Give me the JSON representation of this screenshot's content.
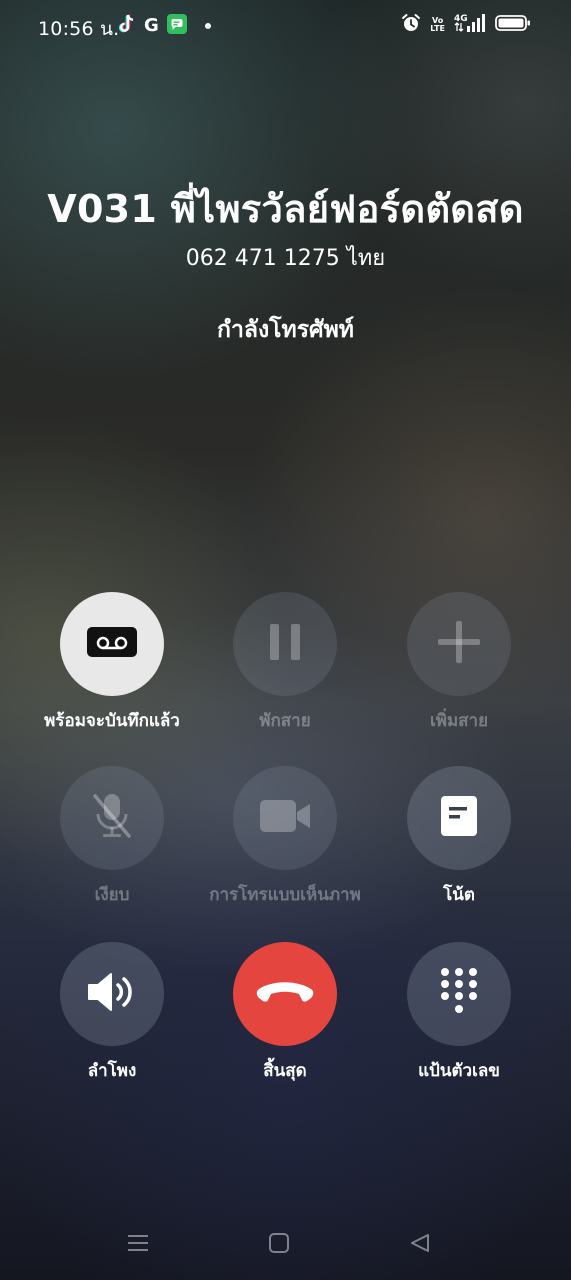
{
  "status_bar": {
    "time": "10:56 น.",
    "notification_icons": [
      "tiktok-icon",
      "google-icon",
      "messages-icon",
      "more-notifications-dot"
    ],
    "google_letter": "G",
    "system_icons": [
      "alarm-icon",
      "volte-icon",
      "4g-signal-icon",
      "battery-icon"
    ],
    "volte_top": "Vo",
    "volte_bottom": "LTE",
    "network_label": "4G"
  },
  "caller": {
    "name": "V031 พี่ไพรวัลย์ฟอร์ดตัดสด",
    "number": "062 471 1275 ไทย",
    "status": "กำลังโทรศัพท์"
  },
  "controls": {
    "record": {
      "label": "พร้อมจะบันทึกแล้ว",
      "icon": "voicemail-record-icon"
    },
    "hold": {
      "label": "พักสาย",
      "icon": "pause-icon"
    },
    "add_call": {
      "label": "เพิ่มสาย",
      "icon": "plus-icon"
    },
    "mute": {
      "label": "เงียบ",
      "icon": "mic-off-icon"
    },
    "video_call": {
      "label": "การโทรแบบเห็นภาพ",
      "icon": "video-camera-icon"
    },
    "notes": {
      "label": "โน้ต",
      "icon": "note-icon"
    },
    "speaker": {
      "label": "ลำโพง",
      "icon": "speaker-icon"
    },
    "end_call": {
      "label": "สิ้นสุด",
      "icon": "hang-up-icon"
    },
    "keypad": {
      "label": "แป้นตัวเลข",
      "icon": "dialpad-icon"
    }
  },
  "colors": {
    "end_call_red": "#e4463f",
    "active_button": "#e8e8e8"
  },
  "nav_bar": {
    "buttons": [
      "menu-icon",
      "home-icon",
      "back-icon"
    ]
  }
}
